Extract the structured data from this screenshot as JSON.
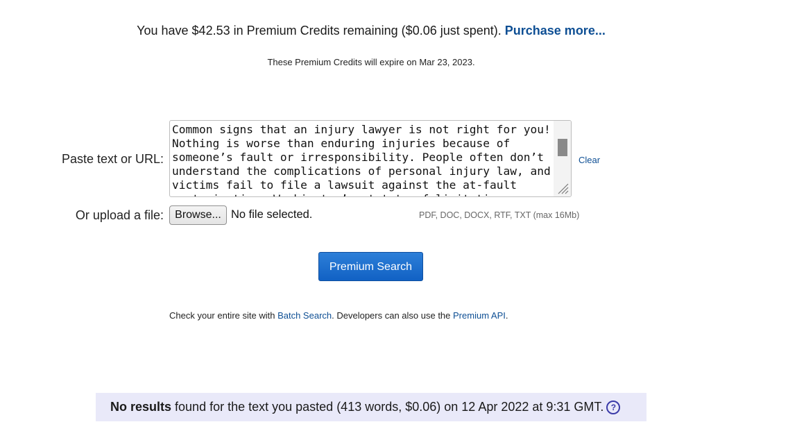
{
  "credits": {
    "text": "You have $42.53 in Premium Credits remaining ($0.06 just spent). ",
    "purchase_link": "Purchase more...",
    "expire_text": "These Premium Credits will expire on Mar 23, 2023."
  },
  "form": {
    "paste_label": "Paste text or URL:",
    "textarea_value": "Common signs that an injury lawyer is not right for you!\nNothing is worse than enduring injuries because of someone’s fault or irresponsibility. People often don’t understand the complications of personal injury law, and victims fail to file a lawsuit against the at-fault party in time. Washington’s statute of limitations",
    "clear_link": "Clear",
    "upload_label": "Or upload a file:",
    "browse_button": "Browse...",
    "no_file_text": "No file selected.",
    "file_types": "PDF, DOC, DOCX, RTF, TXT (max 16Mb)",
    "search_button": "Premium Search"
  },
  "batch": {
    "prefix": "Check your entire site with ",
    "batch_link": "Batch Search",
    "middle": ". Developers can also use the ",
    "api_link": "Premium API",
    "suffix": "."
  },
  "results": {
    "bold": "No results",
    "text": " found for the text you pasted (413 words, $0.06) on 12 Apr 2022 at 9:31 GMT.",
    "help_icon": "?"
  },
  "colors": {
    "link": "#0e4f94",
    "button": "#1161c4",
    "results_bg": "#e9e9f9"
  },
  "icons": {
    "help": "question-circle-icon",
    "resize": "resize-grip-icon"
  }
}
